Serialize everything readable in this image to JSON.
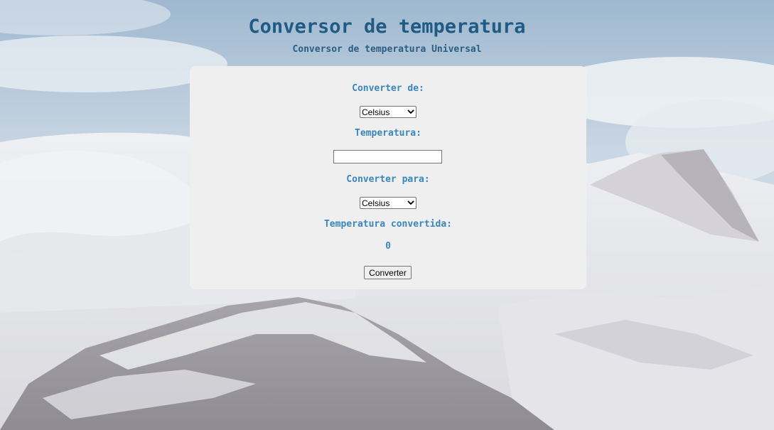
{
  "header": {
    "title": "Conversor de temperatura",
    "subtitle": "Conversor de temperatura Universal"
  },
  "form": {
    "from_label": "Converter de:",
    "from_select": {
      "selected": "Celsius",
      "options": [
        "Celsius"
      ]
    },
    "temperature_label": "Temperatura:",
    "temperature_input": {
      "value": "",
      "placeholder": ""
    },
    "to_label": "Converter para:",
    "to_select": {
      "selected": "Celsius",
      "options": [
        "Celsius"
      ]
    },
    "converted_label": "Temperatura convertida:",
    "converted_value": "0",
    "convert_button": "Converter"
  },
  "colors": {
    "title": "#1f5b85",
    "label": "#3a86c0",
    "card": "#efefef"
  },
  "icons": {
    "select_arrow": "chevron-down-icon"
  }
}
